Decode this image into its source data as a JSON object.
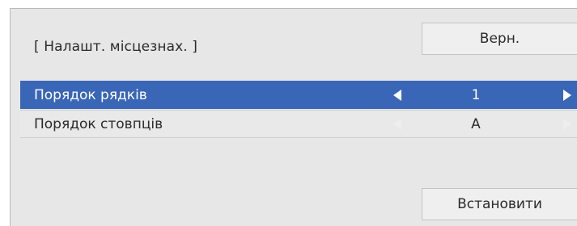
{
  "header": {
    "title": "[ Налашт. місцезнах. ]",
    "back_label": "Верн."
  },
  "rows": [
    {
      "label": "Порядок рядків",
      "value": "1",
      "selected": true
    },
    {
      "label": "Порядок стовпців",
      "value": "A",
      "selected": false
    }
  ],
  "footer": {
    "apply_label": "Встановити"
  },
  "colors": {
    "panel_bg": "#e7e7e7",
    "selected_row": "#3a66b7",
    "button_bg": "#efefef",
    "text": "#2a2a2a"
  },
  "icons": {
    "left_arrow": "triangle-left",
    "right_arrow": "triangle-right"
  }
}
